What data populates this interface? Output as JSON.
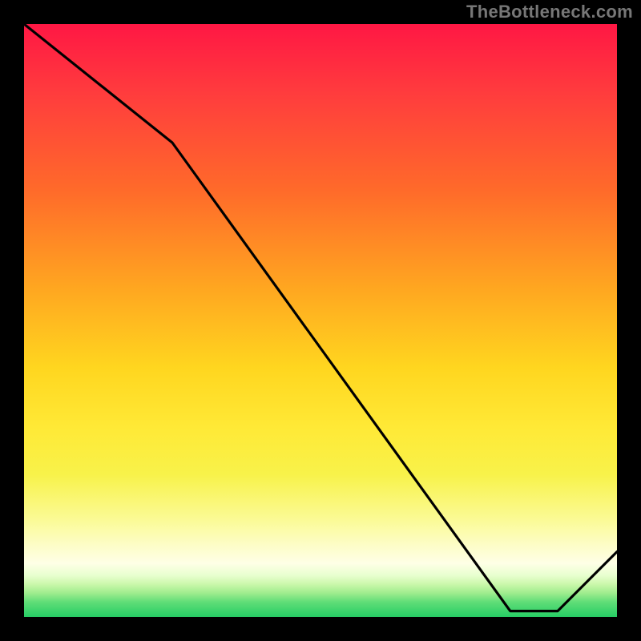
{
  "watermark": "TheBottleneck.com",
  "chart_data": {
    "type": "line",
    "title": "",
    "xlabel": "",
    "ylabel": "",
    "xlim": [
      0,
      100
    ],
    "ylim": [
      0,
      100
    ],
    "grid": false,
    "legend": false,
    "x": [
      0,
      25,
      82,
      90,
      100
    ],
    "y": [
      100,
      80,
      1,
      1,
      11
    ],
    "series_label": "",
    "colors": {
      "line": "#000000",
      "gradient_top": "#ff1744",
      "gradient_mid": "#ffe936",
      "gradient_bottom": "#26cd65"
    }
  },
  "series_label_text": ""
}
